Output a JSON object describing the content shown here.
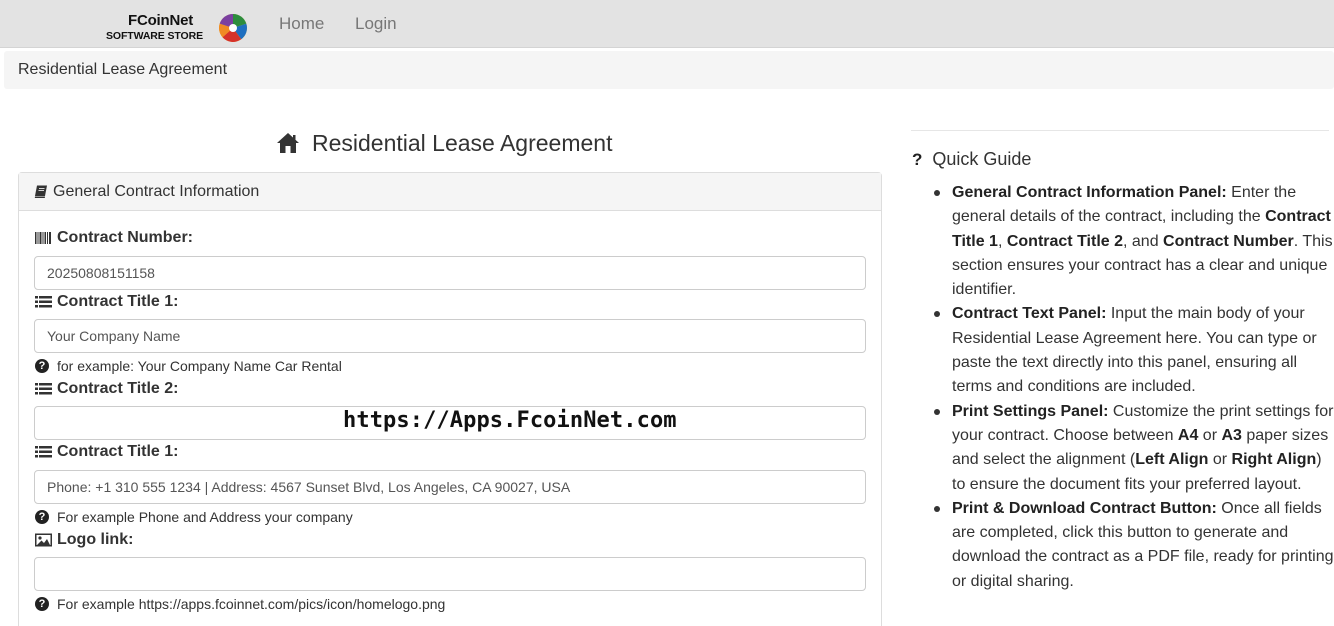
{
  "navbar": {
    "logo_line1": "FCoinNet",
    "logo_line2": "SOFTWARE STORE",
    "links": [
      {
        "label": "Home"
      },
      {
        "label": "Login"
      }
    ]
  },
  "breadcrumb": {
    "label": "Residential Lease Agreement"
  },
  "page": {
    "title": "Residential Lease Agreement"
  },
  "panel": {
    "heading": "General Contract Information",
    "fields": [
      {
        "label": "Contract Number:",
        "value": "20250808151158",
        "placeholder": ""
      },
      {
        "label": "Contract Title 1:",
        "value": "",
        "placeholder": "Your Company Name",
        "help": "for example: Your Company Name Car Rental"
      },
      {
        "label": "Contract Title 2:",
        "value": "",
        "placeholder": ""
      },
      {
        "label": "Contract Title 1:",
        "value": "Phone: +1 310 555 1234 | Address: 4567 Sunset Blvd, Los Angeles, CA 90027, USA",
        "placeholder": "",
        "help": "For example Phone and Address your company"
      },
      {
        "label": "Logo link:",
        "value": "",
        "placeholder": "",
        "help": "For example https://apps.fcoinnet.com/pics/icon/homelogo.png"
      }
    ]
  },
  "watermark": "https://Apps.FcoinNet.com",
  "guide": {
    "title": "Quick Guide",
    "items": [
      [
        {
          "b": "General Contract Information Panel:"
        },
        {
          "t": " Enter the general details of the contract, including the "
        },
        {
          "b": "Contract Title 1"
        },
        {
          "t": ", "
        },
        {
          "b": "Contract Title 2"
        },
        {
          "t": ", and "
        },
        {
          "b": "Contract Number"
        },
        {
          "t": ". This section ensures your contract has a clear and unique identifier."
        }
      ],
      [
        {
          "b": "Contract Text Panel:"
        },
        {
          "t": " Input the main body of your Residential Lease Agreement here. You can type or paste the text directly into this panel, ensuring all terms and conditions are included."
        }
      ],
      [
        {
          "b": "Print Settings Panel:"
        },
        {
          "t": " Customize the print settings for your contract. Choose between "
        },
        {
          "b": "A4"
        },
        {
          "t": " or "
        },
        {
          "b": "A3"
        },
        {
          "t": " paper sizes and select the alignment ("
        },
        {
          "b": "Left Align"
        },
        {
          "t": " or "
        },
        {
          "b": "Right Align"
        },
        {
          "t": ") to ensure the document fits your preferred layout."
        }
      ],
      [
        {
          "b": "Print & Download Contract Button:"
        },
        {
          "t": " Once all fields are completed, click this button to generate and download the contract as a PDF file, ready for printing or digital sharing."
        }
      ]
    ]
  },
  "icons": {
    "home": "home-icon",
    "book": "book-icon",
    "barcode": "barcode-icon",
    "list": "list-icon",
    "image": "image-icon",
    "question": "question-circle-icon"
  },
  "colors": {
    "navbar_bg": "#e3e3e3",
    "crumb_bg": "#f5f5f5",
    "panel_heading_bg": "#f5f5f5",
    "nav_link": "#777777",
    "text": "#333333"
  }
}
